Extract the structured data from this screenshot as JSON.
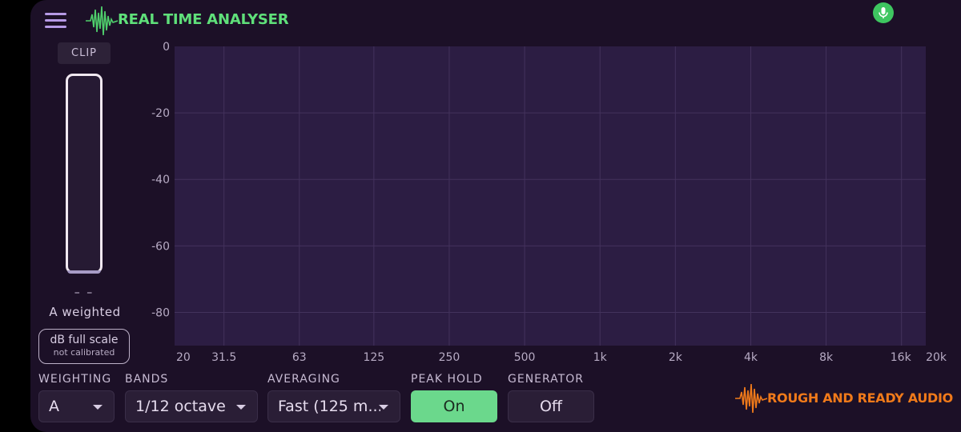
{
  "header": {
    "title": "REAL TIME ANALYSER",
    "accent_color": "#5fe07a",
    "mic_color": "#3ec660"
  },
  "meter": {
    "clip_label": "CLIP",
    "level_readout": "– –",
    "weighting_label": "A weighted",
    "scale_line1": "dB full scale",
    "scale_line2": "not calibrated"
  },
  "chart_data": {
    "type": "bar",
    "title": "",
    "xlabel": "",
    "ylabel": "",
    "x_scale": "log",
    "ylim": [
      -90,
      0
    ],
    "y_ticks": [
      0,
      -20,
      -40,
      -60,
      -80
    ],
    "x_tick_labels": [
      "20",
      "31.5",
      "63",
      "125",
      "250",
      "500",
      "1k",
      "2k",
      "4k",
      "8k",
      "16k",
      "20k"
    ],
    "x_tick_values": [
      20,
      31.5,
      63,
      125,
      250,
      500,
      1000,
      2000,
      4000,
      8000,
      16000,
      20000
    ],
    "grid": true,
    "series": []
  },
  "controls": {
    "weighting": {
      "label": "WEIGHTING",
      "value": "A"
    },
    "bands": {
      "label": "BANDS",
      "value": "1/12 octave"
    },
    "averaging": {
      "label": "AVERAGING",
      "value": "Fast (125 m..."
    },
    "peak_hold": {
      "label": "PEAK HOLD",
      "value": "On",
      "color": "#6bd88c"
    },
    "generator": {
      "label": "GENERATOR",
      "value": "Off"
    }
  },
  "brand": {
    "text": "ROUGH AND READY AUDIO",
    "color": "#f07a1a"
  }
}
